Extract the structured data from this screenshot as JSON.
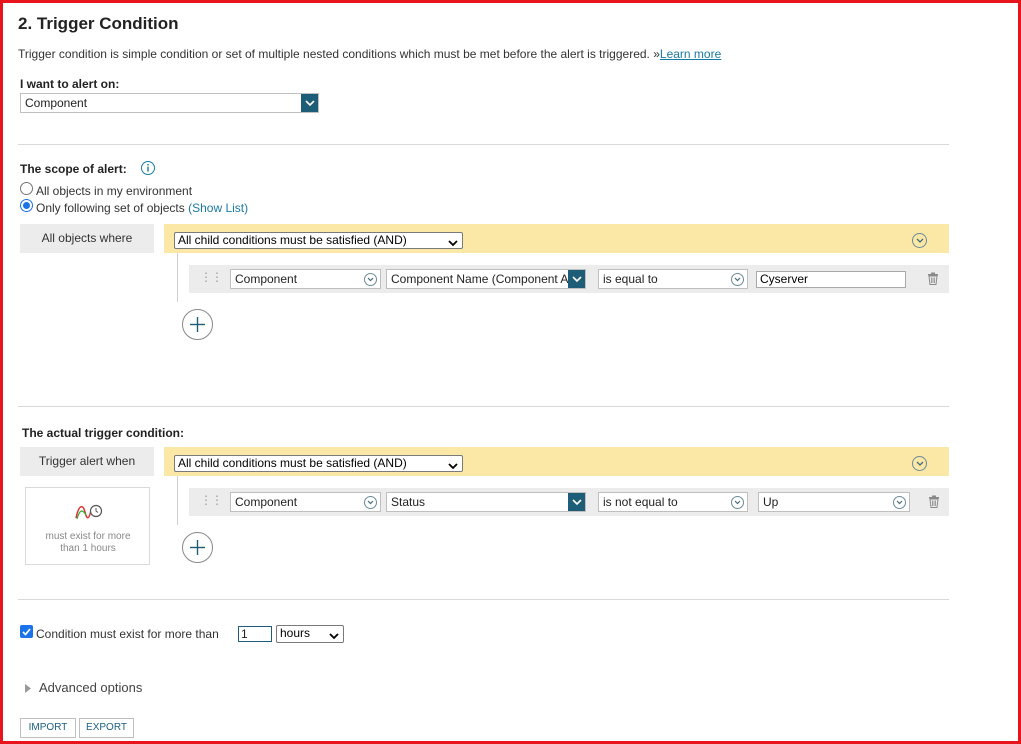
{
  "header": {
    "title": "2. Trigger Condition",
    "description": "Trigger condition is simple condition or set of multiple nested conditions which must be met before the alert is triggered. »",
    "learn_more": "Learn more"
  },
  "alert_on": {
    "label": "I want to alert on:",
    "value": "Component"
  },
  "scope": {
    "label": "The scope of alert:",
    "radio_all": "All objects in my environment",
    "radio_following": "Only following set of objects",
    "show_list": "(Show List)",
    "selected": "following",
    "tab_label": "All objects where",
    "group_select": "All child conditions must be satisfied (AND)",
    "condition": {
      "object": "Component",
      "property": "Component Name (Component A",
      "operator": "is equal to",
      "value": "Cyserver"
    }
  },
  "trigger": {
    "label": "The actual trigger condition:",
    "tab_label": "Trigger alert when",
    "group_select": "All child conditions must be satisfied (AND)",
    "summary_text": "must exist for more than 1 hours",
    "condition": {
      "object": "Component",
      "property": "Status",
      "operator": "is not equal to",
      "value": "Up"
    }
  },
  "time_condition": {
    "checked": true,
    "label": "Condition must exist for more than",
    "value": "1",
    "unit": "hours"
  },
  "advanced": {
    "label": "Advanced options"
  },
  "buttons": {
    "import": "IMPORT",
    "export": "EXPORT"
  },
  "colors": {
    "frame_border": "#e8141b",
    "link": "#1a7aa5",
    "dropdown_accent": "#1e5d78",
    "condition_bar": "#fbe7a6",
    "condition_row": "#ececec"
  }
}
